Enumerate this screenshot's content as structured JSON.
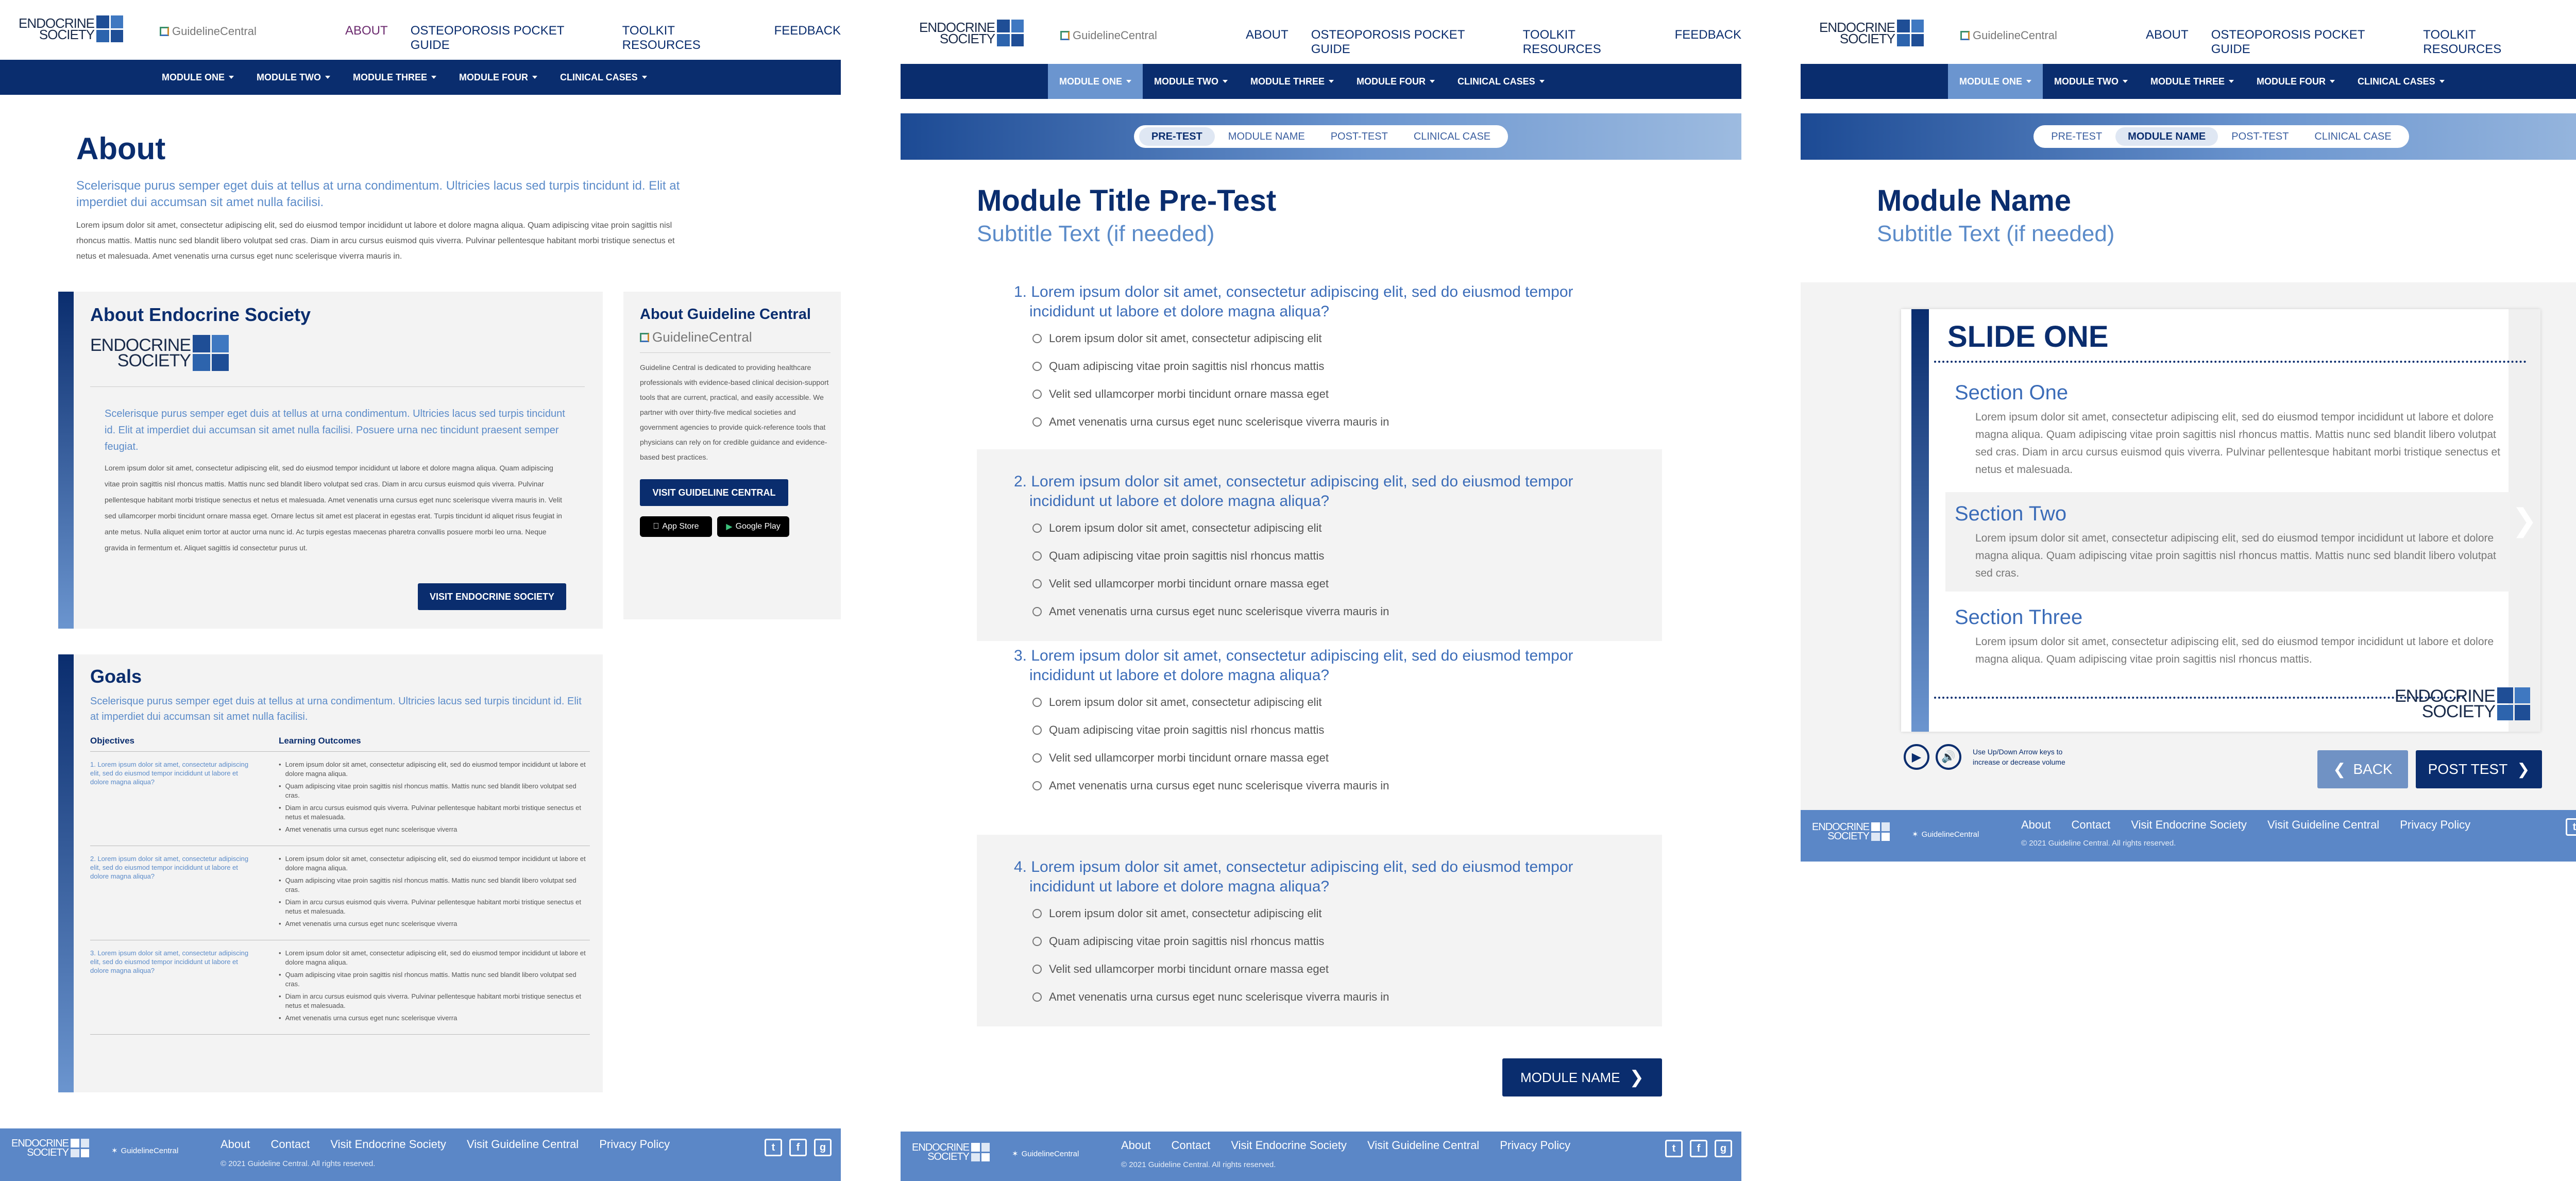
{
  "brand": {
    "endocrine": "ENDOCRINE SOCIETY",
    "endocrine_line1": "ENDOCRINE",
    "endocrine_line2": "SOCIETY",
    "guideline": "GuidelineCentral"
  },
  "top_nav": [
    "ABOUT",
    "OSTEOPOROSIS POCKET GUIDE",
    "TOOLKIT RESOURCES",
    "FEEDBACK"
  ],
  "module_nav": [
    "MODULE ONE",
    "MODULE TWO",
    "MODULE THREE",
    "MODULE FOUR",
    "CLINICAL CASES"
  ],
  "steps": [
    "PRE-TEST",
    "MODULE NAME",
    "POST-TEST",
    "CLINICAL CASE"
  ],
  "about": {
    "title": "About",
    "lead": "Scelerisque purus semper eget duis at tellus at urna condimentum. Ultricies lacus sed turpis tincidunt id. Elit at imperdiet dui accumsan sit amet nulla facilisi.",
    "body": "Lorem ipsum dolor sit amet, consectetur adipiscing elit, sed do eiusmod tempor incididunt ut labore et dolore magna aliqua. Quam adipiscing vitae proin sagittis nisl rhoncus mattis. Mattis nunc sed blandit libero volutpat sed cras. Diam in arcu cursus euismod quis viverra. Pulvinar pellentesque habitant morbi tristique senectus et netus et malesuada. Amet venenatis urna cursus eget nunc scelerisque viverra mauris in.",
    "es_card": {
      "title": "About Endocrine Society",
      "lead": "Scelerisque purus semper eget duis at tellus at urna condimentum. Ultricies lacus sed turpis tincidunt id. Elit at imperdiet dui accumsan sit amet nulla facilisi. Posuere urna nec tincidunt praesent semper feugiat.",
      "body": "Lorem ipsum dolor sit amet, consectetur adipiscing elit, sed do eiusmod tempor incididunt ut labore et dolore magna aliqua. Quam adipiscing vitae proin sagittis nisl rhoncus mattis. Mattis nunc sed blandit libero volutpat sed cras. Diam in arcu cursus euismod quis viverra. Pulvinar pellentesque habitant morbi tristique senectus et netus et malesuada. Amet venenatis urna cursus eget nunc scelerisque viverra mauris in. Velit sed ullamcorper morbi tincidunt ornare massa eget. Ornare lectus sit amet est placerat in egestas erat. Turpis tincidunt id aliquet risus feugiat in ante metus. Nulla aliquet enim tortor at auctor urna nunc id. Ac turpis egestas maecenas pharetra convallis posuere morbi leo urna. Neque gravida in fermentum et. Aliquet sagittis id consectetur purus ut.",
      "button": "VISIT ENDOCRINE SOCIETY"
    },
    "gc_card": {
      "title": "About Guideline Central",
      "body": "Guideline Central is dedicated to providing healthcare professionals with evidence-based clinical decision-support tools that are current, practical, and easily accessible. We partner with over thirty-five medical societies and government agencies to provide quick-reference tools that physicians can rely on for credible guidance and evidence-based best practices.",
      "button": "VISIT GUIDELINE CENTRAL",
      "app_store": "App Store",
      "google_play": "Google Play"
    },
    "goals": {
      "title": "Goals",
      "lead": "Scelerisque purus semper eget duis at tellus at urna condimentum. Ultricies lacus sed turpis tincidunt id. Elit at imperdiet dui accumsan sit amet nulla facilisi.",
      "col1": "Objectives",
      "col2": "Learning Outcomes",
      "rows": [
        {
          "obj": "1. Lorem ipsum dolor sit amet, consectetur adipiscing elit, sed do eiusmod tempor incididunt ut labore et dolore magna aliqua?",
          "items": [
            "Lorem ipsum dolor sit amet, consectetur adipiscing elit, sed do eiusmod tempor incididunt ut labore et dolore magna aliqua.",
            "Quam adipiscing vitae proin sagittis nisl rhoncus mattis. Mattis nunc sed blandit libero volutpat sed cras.",
            "Diam in arcu cursus euismod quis viverra. Pulvinar pellentesque habitant morbi tristique senectus et netus et malesuada.",
            "Amet venenatis urna cursus eget nunc scelerisque viverra"
          ]
        },
        {
          "obj": "2. Lorem ipsum dolor sit amet, consectetur adipiscing elit, sed do eiusmod tempor incididunt ut labore et dolore magna aliqua?",
          "items": [
            "Lorem ipsum dolor sit amet, consectetur adipiscing elit, sed do eiusmod tempor incididunt ut labore et dolore magna aliqua.",
            "Quam adipiscing vitae proin sagittis nisl rhoncus mattis. Mattis nunc sed blandit libero volutpat sed cras.",
            "Diam in arcu cursus euismod quis viverra. Pulvinar pellentesque habitant morbi tristique senectus et netus et malesuada.",
            "Amet venenatis urna cursus eget nunc scelerisque viverra"
          ]
        },
        {
          "obj": "3. Lorem ipsum dolor sit amet, consectetur adipiscing elit, sed do eiusmod tempor incididunt ut labore et dolore magna aliqua?",
          "items": [
            "Lorem ipsum dolor sit amet, consectetur adipiscing elit, sed do eiusmod tempor incididunt ut labore et dolore magna aliqua.",
            "Quam adipiscing vitae proin sagittis nisl rhoncus mattis. Mattis nunc sed blandit libero volutpat sed cras.",
            "Diam in arcu cursus euismod quis viverra. Pulvinar pellentesque habitant morbi tristique senectus et netus et malesuada.",
            "Amet venenatis urna cursus eget nunc scelerisque viverra"
          ]
        }
      ]
    }
  },
  "pretest": {
    "title": "Module Title Pre-Test",
    "subtitle": "Subtitle Text (if needed)",
    "questions": [
      {
        "q": "1. Lorem ipsum dolor sit amet, consectetur adipiscing elit, sed do eiusmod tempor incididunt ut labore et dolore magna aliqua?"
      },
      {
        "q": "2. Lorem ipsum dolor sit amet, consectetur adipiscing elit, sed do eiusmod tempor incididunt ut labore et dolore magna aliqua?"
      },
      {
        "q": "3. Lorem ipsum dolor sit amet, consectetur adipiscing elit, sed do eiusmod tempor incididunt ut labore et dolore magna aliqua?"
      },
      {
        "q": "4. Lorem ipsum dolor sit amet, consectetur adipiscing elit, sed do eiusmod tempor incididunt ut labore et dolore magna aliqua?"
      }
    ],
    "options": [
      "Lorem ipsum dolor sit amet, consectetur adipiscing elit",
      "Quam adipiscing vitae proin sagittis nisl rhoncus mattis",
      "Velit sed ullamcorper morbi tincidunt ornare massa eget",
      "Amet venenatis urna cursus eget nunc scelerisque viverra mauris in"
    ],
    "next_button": "MODULE NAME"
  },
  "module": {
    "title": "Module Name",
    "subtitle": "Subtitle Text (if needed)",
    "slide_title": "SLIDE ONE",
    "sections": [
      {
        "title": "Section One",
        "text": "Lorem ipsum dolor sit amet, consectetur adipiscing elit, sed do eiusmod tempor incididunt ut labore et dolore magna aliqua. Quam adipiscing vitae proin sagittis nisl rhoncus mattis. Mattis nunc sed blandit libero volutpat sed cras. Diam in arcu cursus euismod quis viverra. Pulvinar pellentesque habitant morbi tristique senectus et netus et malesuada."
      },
      {
        "title": "Section Two",
        "text": "Lorem ipsum dolor sit amet, consectetur adipiscing elit, sed do eiusmod tempor incididunt ut labore et dolore magna aliqua. Quam adipiscing vitae proin sagittis nisl rhoncus mattis. Mattis nunc sed blandit libero volutpat sed cras."
      },
      {
        "title": "Section Three",
        "text": "Lorem ipsum dolor sit amet, consectetur adipiscing elit, sed do eiusmod tempor incididunt ut labore et dolore magna aliqua. Quam adipiscing vitae proin sagittis nisl rhoncus mattis."
      }
    ],
    "hint_line1": "Use Up/Down Arrow keys to",
    "hint_line2": "increase or decrease volume",
    "back_button": "BACK",
    "post_button": "POST TEST"
  },
  "footer": {
    "links": [
      "About",
      "Contact",
      "Visit Endocrine Society",
      "Visit Guideline Central",
      "Privacy Policy"
    ],
    "copyright": "© 2021 Guideline Central. All rights reserved."
  },
  "colors": {
    "navy": "#0a2d6e",
    "accent_blue": "#5b8bc9",
    "footer": "#5b87c7",
    "active_nav": "#6b2a6e"
  }
}
